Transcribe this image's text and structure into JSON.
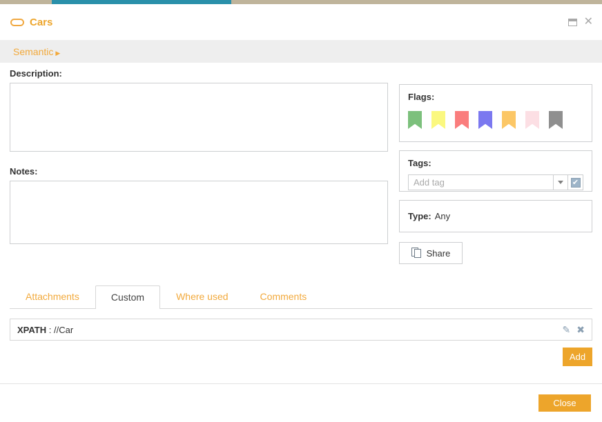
{
  "window": {
    "title": "Cars",
    "title_icon": "oval-outline-icon",
    "restore_icon": "restore-window-icon",
    "close_icon": "close-window-icon",
    "accent_color": "#eda52b",
    "strip_color": "#bfb49b",
    "progress_color": "#2a90aa"
  },
  "breadcrumb": {
    "label": "Semantic",
    "caret": "▶"
  },
  "description": {
    "label": "Description:",
    "value": "",
    "placeholder": ""
  },
  "notes": {
    "label": "Notes:",
    "value": "",
    "placeholder": ""
  },
  "flags": {
    "label": "Flags:",
    "items": [
      {
        "name": "flag-green",
        "color": "#7cc07c"
      },
      {
        "name": "flag-yellow",
        "color": "#fbf87f"
      },
      {
        "name": "flag-red",
        "color": "#fa7d7d"
      },
      {
        "name": "flag-blue",
        "color": "#7b78f0"
      },
      {
        "name": "flag-orange",
        "color": "#fcc766"
      },
      {
        "name": "flag-pink",
        "color": "#fcdfe4"
      },
      {
        "name": "flag-gray",
        "color": "#8f8f8f"
      }
    ]
  },
  "tags": {
    "label": "Tags:",
    "input_value": "",
    "placeholder": "Add tag",
    "dropdown_icon": "chevron-down-icon",
    "confirm_icon": "checkbox-checked-icon",
    "confirm_glyph": "✔"
  },
  "type": {
    "label": "Type:",
    "value": "Any"
  },
  "share": {
    "label": "Share",
    "icon": "copy-documents-icon"
  },
  "tabs": [
    {
      "label": "Attachments",
      "active": false
    },
    {
      "label": "Custom",
      "active": true
    },
    {
      "label": "Where used",
      "active": false
    },
    {
      "label": "Comments",
      "active": false
    }
  ],
  "custom_property": {
    "key": "XPATH",
    "separator": " : ",
    "value": "//Car",
    "edit_icon": "pencil-edit-icon",
    "edit_glyph": "✎",
    "delete_icon": "delete-x-icon",
    "delete_glyph": "✖"
  },
  "add_button": {
    "label": "Add"
  },
  "close_button": {
    "label": "Close"
  }
}
